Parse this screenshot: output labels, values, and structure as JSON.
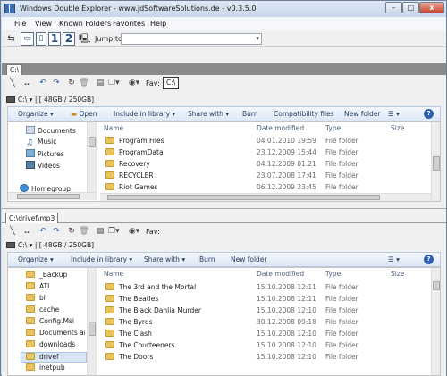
{
  "app": {
    "title": "Windows Double Explorer - www.jdSoftwareSolutions.de - v0.3.5.0"
  },
  "window_buttons": {
    "minimize": "–",
    "maximize": "□",
    "close": "x"
  },
  "menu": [
    "File",
    "View",
    "Known Folders",
    "Favorites",
    "Help"
  ],
  "toolbar": {
    "layout_1": "1",
    "layout_2": "2",
    "jump_label": "Jump to",
    "jump_value": ""
  },
  "top_pane": {
    "tab": "C:\\",
    "fav_label": "Fav:",
    "fav_value": "C:\\",
    "drive_text": "C:\\ ▾  |  [ 48GB / 250GB]",
    "commands": [
      "Organize ▾",
      "Open",
      "Include in library ▾",
      "Share with ▾",
      "Burn",
      "Compatibility files",
      "New folder"
    ],
    "nav": [
      "Documents",
      "Music",
      "Pictures",
      "Videos",
      "Homegroup"
    ],
    "columns": {
      "name": "Name",
      "date": "Date modified",
      "type": "Type",
      "size": "Size"
    },
    "rows": [
      {
        "name": "Program Files",
        "date": "04.01.2010 19:59",
        "type": "File folder"
      },
      {
        "name": "ProgramData",
        "date": "23.12.2009 15:44",
        "type": "File folder"
      },
      {
        "name": "Recovery",
        "date": "04.12.2009 01:21",
        "type": "File folder"
      },
      {
        "name": "RECYCLER",
        "date": "23.07.2008 17:41",
        "type": "File folder"
      },
      {
        "name": "Riot Games",
        "date": "06.12.2009 23:45",
        "type": "File folder"
      }
    ]
  },
  "bottom_pane": {
    "tab": "C:\\drivef\\mp3",
    "fav_label": "Fav:",
    "drive_text": "C:\\ ▾  |  [ 48GB / 250GB]",
    "commands": [
      "Organize ▾",
      "Include in library ▾",
      "Share with ▾",
      "Burn",
      "New folder"
    ],
    "nav": [
      "_Backup",
      "ATI",
      "bl",
      "cache",
      "Config.Msi",
      "Documents and",
      "downloads",
      "drivef",
      "inetpub"
    ],
    "columns": {
      "name": "Name",
      "date": "Date modified",
      "type": "Type",
      "size": "Size"
    },
    "rows": [
      {
        "name": "The 3rd and the Mortal",
        "date": "15.10.2008 12:11",
        "type": "File folder"
      },
      {
        "name": "The Beatles",
        "date": "15.10.2008 12:11",
        "type": "File folder"
      },
      {
        "name": "The Black Dahlia Murder",
        "date": "15.10.2008 12:10",
        "type": "File folder"
      },
      {
        "name": "The Byrds",
        "date": "30.12.2008 09:18",
        "type": "File folder"
      },
      {
        "name": "The Clash",
        "date": "15.10.2008 12:10",
        "type": "File folder"
      },
      {
        "name": "The Courteeners",
        "date": "15.10.2008 12:10",
        "type": "File folder"
      },
      {
        "name": "The Doors",
        "date": "15.10.2008 12:10",
        "type": "File folder"
      }
    ]
  },
  "colors": {
    "folder": "#e8c45e",
    "cmd_text": "#1e395b",
    "help": "#2d5fb3",
    "tab_strip": "#8a8a8a"
  }
}
